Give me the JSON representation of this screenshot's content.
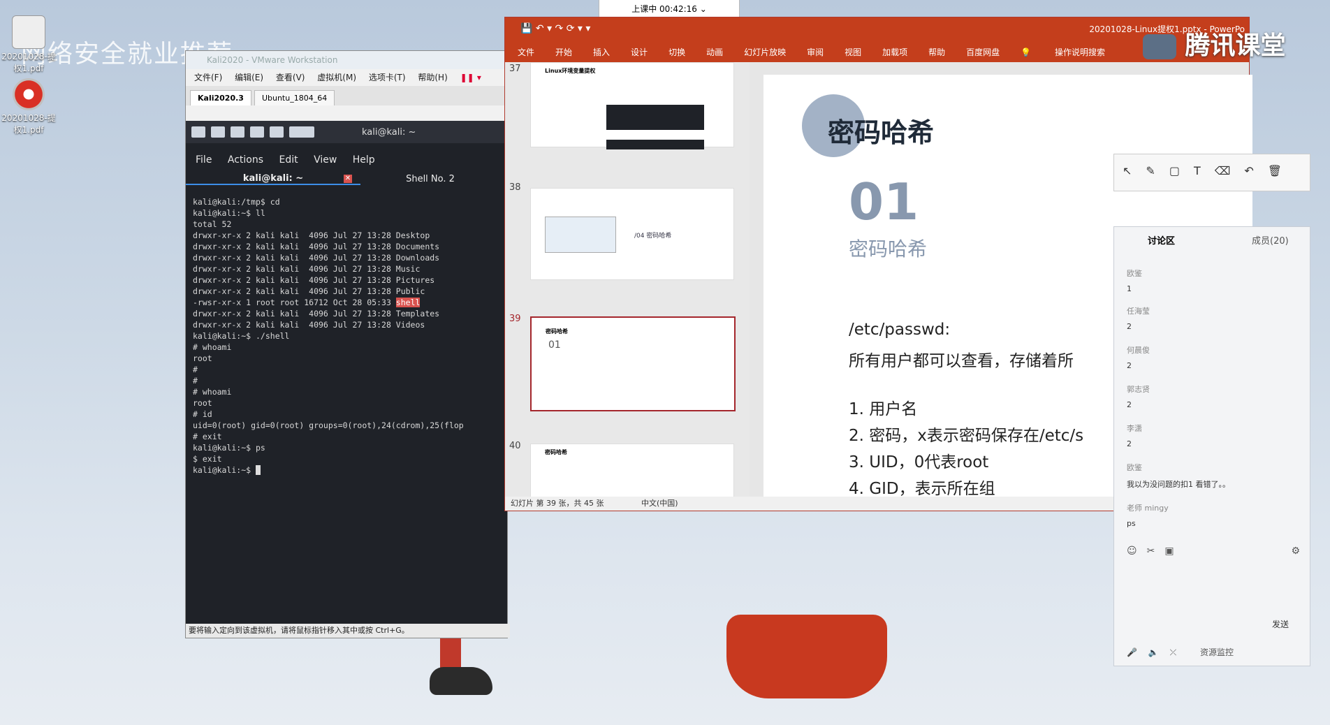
{
  "desktop": {
    "watermark": "网络安全就业推荐",
    "icons": [
      {
        "label": "20201028-提权1.pdf",
        "icon": "pdf-icon"
      },
      {
        "label": "20201028-提权1.pdf",
        "icon": "chrome-icon"
      }
    ]
  },
  "badge": {
    "text": "上课中 00:42:16"
  },
  "vmware": {
    "title": "Kali2020 - VMware Workstation",
    "menu": [
      "文件(F)",
      "编辑(E)",
      "查看(V)",
      "虚拟机(M)",
      "选项卡(T)",
      "帮助(H)"
    ],
    "tabs": [
      "Kali2020.3",
      "Ubuntu_1804_64"
    ],
    "kali_title": "kali@kali: ~",
    "term_menu": [
      "File",
      "Actions",
      "Edit",
      "View",
      "Help"
    ],
    "term_tabs": [
      "kali@kali: ~",
      "Shell No. 2"
    ],
    "status": "要将输入定向到该虚拟机，请将鼠标指针移入其中或按 Ctrl+G。",
    "terminal_lines": [
      "kali@kali:/tmp$ cd",
      "kali@kali:~$ ll",
      "total 52",
      "drwxr-xr-x 2 kali kali  4096 Jul 27 13:28 Desktop",
      "drwxr-xr-x 2 kali kali  4096 Jul 27 13:28 Documents",
      "drwxr-xr-x 2 kali kali  4096 Jul 27 13:28 Downloads",
      "drwxr-xr-x 2 kali kali  4096 Jul 27 13:28 Music",
      "drwxr-xr-x 2 kali kali  4096 Jul 27 13:28 Pictures",
      "drwxr-xr-x 2 kali kali  4096 Jul 27 13:28 Public",
      "-rwsr-xr-x 1 root root 16712 Oct 28 05:33 ",
      "drwxr-xr-x 2 kali kali  4096 Jul 27 13:28 Templates",
      "drwxr-xr-x 2 kali kali  4096 Jul 27 13:28 Videos",
      "kali@kali:~$ ./shell",
      "# whoami",
      "root",
      "#",
      "#",
      "# whoami",
      "root",
      "# id",
      "uid=0(root) gid=0(root) groups=0(root),24(cdrom),25(flop",
      "# exit",
      "kali@kali:~$ ps",
      "$ exit",
      "kali@kali:~$ "
    ],
    "highlight_word": "shell"
  },
  "ppt": {
    "file_title": "20201028-Linux提权1.pptx - PowerPo",
    "ribbon": [
      "文件",
      "开始",
      "插入",
      "设计",
      "切换",
      "动画",
      "幻灯片放映",
      "审阅",
      "视图",
      "加载项",
      "帮助",
      "百度网盘",
      "操作说明搜索"
    ],
    "thumbs": [
      {
        "num": "37",
        "title": "Linux环境变量提权"
      },
      {
        "num": "38",
        "title": "/04 密码哈希"
      },
      {
        "num": "39",
        "title": "密码哈希"
      },
      {
        "num": "40",
        "title": "密码哈希"
      }
    ],
    "slide": {
      "heading": "密码哈希",
      "number": "01",
      "subheading": "密码哈希",
      "path": "/etc/passwd:",
      "desc": "所有用户都可以查看，存储着所",
      "items": [
        "1. 用户名",
        "2. 密码，x表示密码保存在/etc/s",
        "3. UID，0代表root",
        "4. GID，表示所在组"
      ]
    },
    "status": "幻灯片 第 39 张，共 45 张",
    "lang": "中文(中国)"
  },
  "tencent": {
    "logo": "腾讯课堂",
    "tabs": [
      "讨论区",
      "成员(20)"
    ],
    "messages": [
      {
        "name": "欧鉴",
        "text": "1"
      },
      {
        "name": "任海莹",
        "text": "2"
      },
      {
        "name": "何晨俊",
        "text": "2"
      },
      {
        "name": "郭志贤",
        "text": "2"
      },
      {
        "name": "李潇",
        "text": "2"
      },
      {
        "name": "欧鉴",
        "text": "我以为没问题的扣1  看错了。。"
      },
      {
        "name": "老师  mingy",
        "text": "ps"
      }
    ],
    "send": "发送",
    "monitor": "资源监控"
  }
}
